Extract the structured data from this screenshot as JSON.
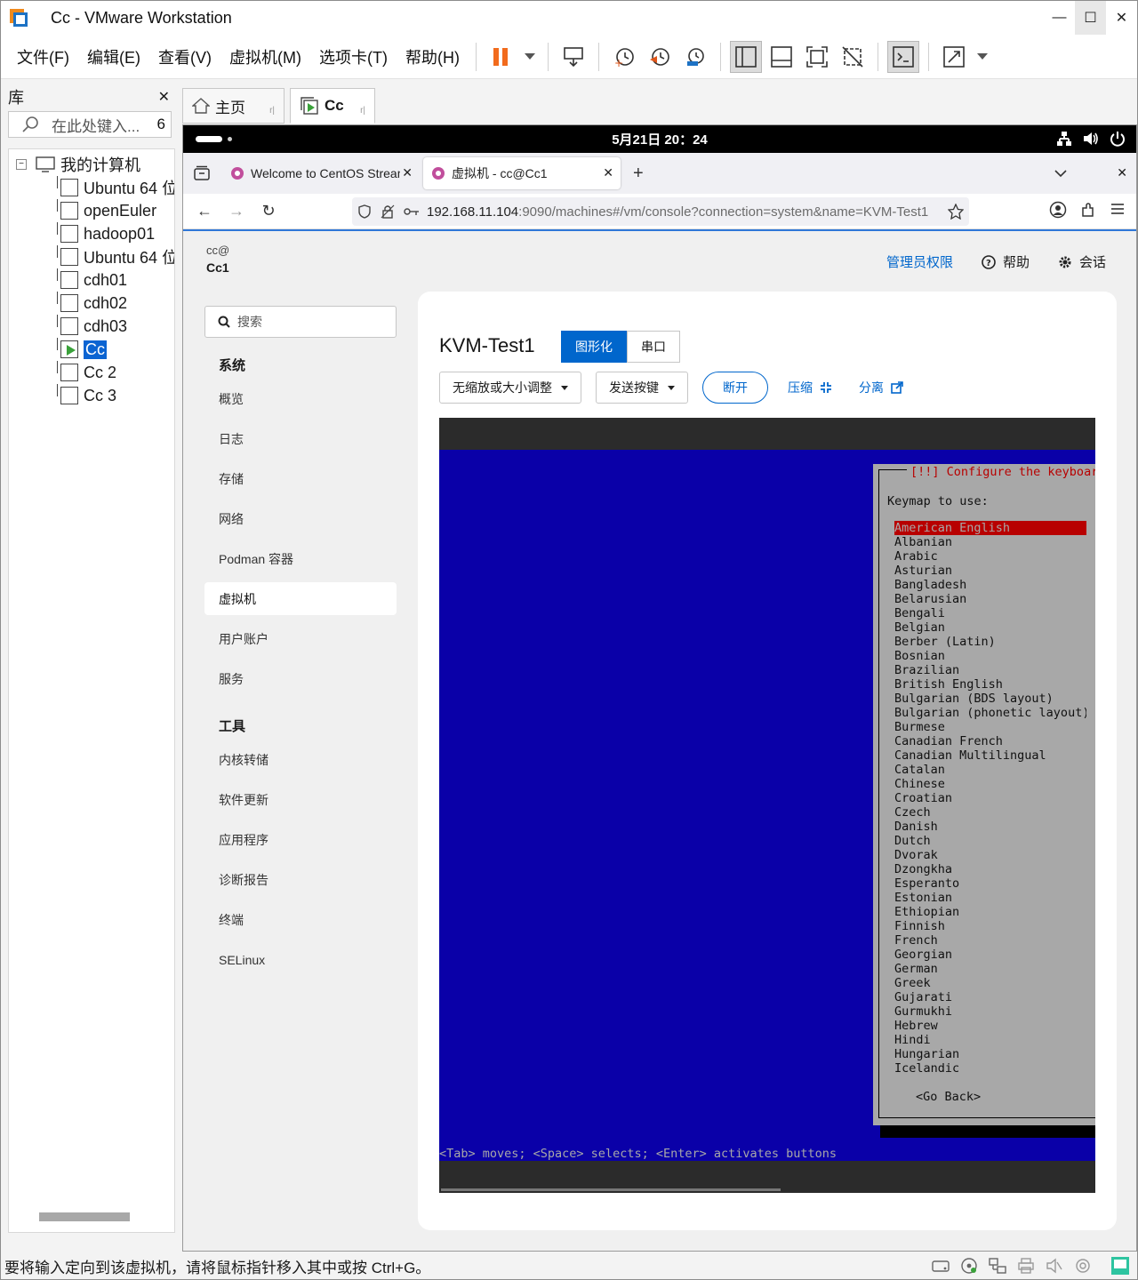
{
  "window": {
    "title": "Cc - VMware Workstation"
  },
  "menu": [
    "文件(F)",
    "编辑(E)",
    "查看(V)",
    "虚拟机(M)",
    "选项卡(T)",
    "帮助(H)"
  ],
  "library": {
    "title": "库",
    "search_placeholder": "在此处键入...",
    "count": "6",
    "root": "我的计算机",
    "items": [
      "Ubuntu 64 位",
      "openEuler",
      "hadoop01",
      "Ubuntu 64 位",
      "cdh01",
      "cdh02",
      "cdh03",
      "Cc",
      "Cc 2",
      "Cc 3"
    ]
  },
  "vm_tabs": {
    "home": "主页",
    "current": "Cc"
  },
  "gnome": {
    "clock": "5月21日  20：24"
  },
  "firefox": {
    "tab1": "Welcome to CentOS Stream",
    "tab2": "虚拟机 - cc@Cc1",
    "url_host": "192.168.11.104",
    "url_rest": ":9090/machines#/vm/console?connection=system&name=KVM-Test1"
  },
  "cockpit": {
    "user": "cc@",
    "host": "Cc1",
    "admin": "管理员权限",
    "help": "帮助",
    "session": "会话",
    "search_placeholder": "搜索",
    "section_system": "系统",
    "system_items": [
      "概览",
      "日志",
      "存储",
      "网络",
      "Podman 容器",
      "虚拟机",
      "用户账户",
      "服务"
    ],
    "section_tools": "工具",
    "tool_items": [
      "内核转储",
      "软件更新",
      "应用程序",
      "诊断报告",
      "终端",
      "SELinux"
    ],
    "vm_name": "KVM-Test1",
    "console_graphic": "图形化",
    "console_serial": "串口",
    "scale_dropdown": "无缩放或大小调整",
    "send_key": "发送按键",
    "disconnect": "断开",
    "compress": "压缩",
    "detach": "分离"
  },
  "console": {
    "dialog_title": "[!!] Configure the keyboard",
    "prompt": "Keymap to use:",
    "keymaps": [
      "American English",
      "Albanian",
      "Arabic",
      "Asturian",
      "Bangladesh",
      "Belarusian",
      "Bengali",
      "Belgian",
      "Berber (Latin)",
      "Bosnian",
      "Brazilian",
      "British English",
      "Bulgarian (BDS layout)",
      "Bulgarian (phonetic layout)",
      "Burmese",
      "Canadian French",
      "Canadian Multilingual",
      "Catalan",
      "Chinese",
      "Croatian",
      "Czech",
      "Danish",
      "Dutch",
      "Dvorak",
      "Dzongkha",
      "Esperanto",
      "Estonian",
      "Ethiopian",
      "Finnish",
      "French",
      "Georgian",
      "German",
      "Greek",
      "Gujarati",
      "Gurmukhi",
      "Hebrew",
      "Hindi",
      "Hungarian",
      "Icelandic"
    ],
    "selected": 0,
    "go_back": "<Go Back>",
    "hint": "<Tab> moves; <Space> selects; <Enter> activates buttons"
  },
  "statusbar": {
    "text": "要将输入定向到该虚拟机，请将鼠标指针移入其中或按 Ctrl+G。"
  },
  "colors": {
    "accent": "#0066cc",
    "console_bg": "#0a00a8",
    "dialog_bg": "#a8a8a8",
    "selection": "#b80000"
  }
}
